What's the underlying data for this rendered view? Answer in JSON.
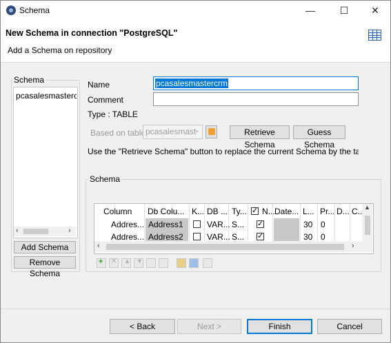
{
  "window": {
    "title": "Schema",
    "minimize": "—",
    "maximize": "☐",
    "close": "✕"
  },
  "header": {
    "title": "New Schema in connection \"PostgreSQL\"",
    "subtitle": "Add a Schema on repository",
    "icon": "table-icon"
  },
  "sidebar": {
    "group_label": "Schema",
    "items": [
      "pcasalesmastercrm"
    ],
    "add_button": "Add Schema",
    "remove_button": "Remove Schema"
  },
  "form": {
    "name_label": "Name",
    "name_value": "pcasalesmastercrm",
    "comment_label": "Comment",
    "comment_value": "",
    "type_text": "Type : TABLE",
    "based_on_label": "Based on table",
    "based_on_value": "pcasalesmast",
    "retrieve_button": "Retrieve Schema",
    "guess_button": "Guess Schema",
    "hint": "Use the \"Retrieve Schema\" button to replace the current Schema by the table ba"
  },
  "schema_table": {
    "group_label": "Schema",
    "headers": [
      "Column",
      "Db Colu...",
      "K...",
      "DB ...",
      "Ty...",
      "N...",
      "Date...",
      "L...",
      "Pr...",
      "D...",
      "C..."
    ],
    "rows": [
      {
        "column": "Addres...",
        "db_column": "Address1",
        "key": false,
        "db_type": "VAR...",
        "type": "S...",
        "nullable": true,
        "date": "",
        "length": "30",
        "precision": "0"
      },
      {
        "column": "Addres...",
        "db_column": "Address2",
        "key": false,
        "db_type": "VAR...",
        "type": "S...",
        "nullable": true,
        "date": "",
        "length": "30",
        "precision": "0"
      }
    ]
  },
  "footer": {
    "back": "< Back",
    "next": "Next >",
    "finish": "Finish",
    "cancel": "Cancel"
  }
}
